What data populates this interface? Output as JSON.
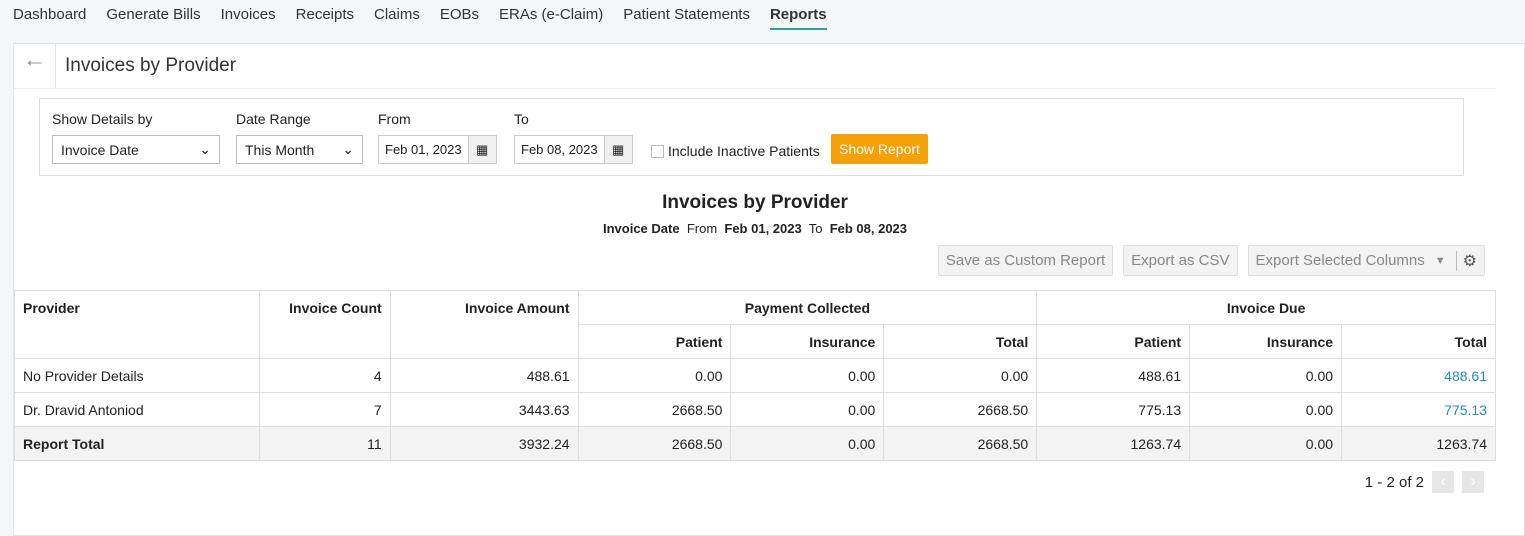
{
  "nav": [
    {
      "label": "Dashboard"
    },
    {
      "label": "Generate Bills"
    },
    {
      "label": "Invoices"
    },
    {
      "label": "Receipts"
    },
    {
      "label": "Claims"
    },
    {
      "label": "EOBs"
    },
    {
      "label": "ERAs (e-Claim)"
    },
    {
      "label": "Patient Statements"
    },
    {
      "label": "Reports",
      "active": true
    }
  ],
  "page_title": "Invoices by Provider",
  "filters": {
    "show_details_label": "Show Details by",
    "show_details_value": "Invoice Date",
    "date_range_label": "Date Range",
    "date_range_value": "This Month",
    "from_label": "From",
    "from_value": "Feb 01, 2023",
    "to_label": "To",
    "to_value": "Feb 08, 2023",
    "include_inactive_label": "Include Inactive Patients",
    "include_inactive_checked": false,
    "show_report": "Show Report"
  },
  "report": {
    "title": "Invoices by Provider",
    "sub_field": "Invoice Date",
    "sub_from": "From",
    "sub_from_date": "Feb 01, 2023",
    "sub_to": "To",
    "sub_to_date": "Feb 08, 2023"
  },
  "actions": {
    "save_custom": "Save as Custom Report",
    "export_csv": "Export as CSV",
    "export_selected": "Export Selected Columns"
  },
  "table": {
    "headers": {
      "provider": "Provider",
      "invoice_count": "Invoice Count",
      "invoice_amount": "Invoice Amount",
      "payment_collected": "Payment Collected",
      "invoice_due": "Invoice Due",
      "patient": "Patient",
      "insurance": "Insurance",
      "total": "Total"
    },
    "rows": [
      [
        "No Provider Details",
        "4",
        "488.61",
        "0.00",
        "0.00",
        "0.00",
        "488.61",
        "0.00",
        "488.61"
      ],
      [
        "Dr. Dravid Antoniod",
        "7",
        "3443.63",
        "2668.50",
        "0.00",
        "2668.50",
        "775.13",
        "0.00",
        "775.13"
      ]
    ],
    "total_row": [
      "Report Total",
      "11",
      "3932.24",
      "2668.50",
      "0.00",
      "2668.50",
      "1263.74",
      "0.00",
      "1263.74"
    ]
  },
  "pagination": {
    "text": "1 - 2 of 2"
  },
  "colors": {
    "accent": "#f5a007",
    "link": "#2a8ac4",
    "active_tab": "#2aa198"
  }
}
